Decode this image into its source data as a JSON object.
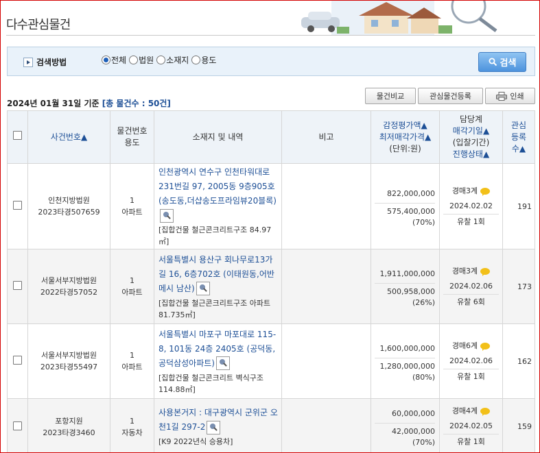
{
  "page_title": "다수관심물건",
  "search": {
    "label": "검색방법",
    "options": [
      "전체",
      "법원",
      "소재지",
      "용도"
    ],
    "selected_index": 0,
    "button": "검색"
  },
  "summary": {
    "date": "2024년 01월 31일 기준",
    "count": "[총 물건수 : 50건]"
  },
  "actions": {
    "compare": "물건비교",
    "register": "관심물건등록",
    "print": "인쇄"
  },
  "columns": {
    "case": "사건번호▲",
    "item_no": "물건번호",
    "usage": "용도",
    "location": "소재지 및 내역",
    "note": "비고",
    "price1": "감정평가액▲",
    "price2": "최저매각가격▲",
    "price3": "(단위:원)",
    "dept": "담당계",
    "sale_date": "매각기일▲",
    "bid_period": "(입찰기간)",
    "status": "진행상태▲",
    "interest1": "관심",
    "interest2": "등록",
    "interest3": "수▲"
  },
  "rows": [
    {
      "court": "인천지방법원",
      "case": "2023타경507659",
      "item": "1",
      "usage": "아파트",
      "addr": "인천광역시 연수구 인천타워대로231번길 97, 2005동 9층905호 (송도동,더샵송도프라임뷰20블록)",
      "detail": "[집합건물 철근콘크리트구조 84.97㎡]",
      "appraisal": "822,000,000",
      "min_price": "575,400,000",
      "ratio": "(70%)",
      "dept": "경매3계",
      "date": "2024.02.02",
      "status": "유찰 1회",
      "interest": "191"
    },
    {
      "court": "서울서부지방법원",
      "case": "2022타경57052",
      "item": "1",
      "usage": "아파트",
      "addr": "서울특별시 용산구 회나무로13가길 16, 6층702호 (이태원동,어반메시 남산)",
      "detail": "[집합건물 철근콘크리트구조 아파트 81.735㎡]",
      "appraisal": "1,911,000,000",
      "min_price": "500,958,000",
      "ratio": "(26%)",
      "dept": "경매3계",
      "date": "2024.02.06",
      "status": "유찰 6회",
      "interest": "173"
    },
    {
      "court": "서울서부지방법원",
      "case": "2023타경55497",
      "item": "1",
      "usage": "아파트",
      "addr": "서울특별시 마포구 마포대로 115-8, 101동 24층 2405호 (공덕동,공덕삼성아파트)",
      "detail": "[집합건물 철근콘크리트 벽식구조 114.88㎡]",
      "appraisal": "1,600,000,000",
      "min_price": "1,280,000,000",
      "ratio": "(80%)",
      "dept": "경매6계",
      "date": "2024.02.06",
      "status": "유찰 1회",
      "interest": "162"
    },
    {
      "court": "포항지원",
      "case": "2023타경3460",
      "item": "1",
      "usage": "자동차",
      "addr": "사용본거지 : 대구광역시 군위군 오천1길 297-2",
      "detail": "[K9 2022년식 승용차]",
      "appraisal": "60,000,000",
      "min_price": "42,000,000",
      "ratio": "(70%)",
      "dept": "경매4계",
      "date": "2024.02.05",
      "status": "유찰 1회",
      "interest": "159"
    }
  ]
}
